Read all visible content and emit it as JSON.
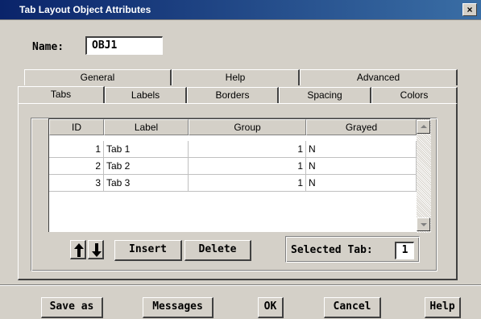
{
  "window": {
    "title": "Tab Layout Object Attributes",
    "close_glyph": "×"
  },
  "name_field": {
    "label": "Name:",
    "value": "OBJ1"
  },
  "tabs_back": [
    "General",
    "Help",
    "Advanced"
  ],
  "tabs_front": [
    "Tabs",
    "Labels",
    "Borders",
    "Spacing",
    "Colors"
  ],
  "active_tab": "Tabs",
  "table": {
    "columns": [
      "ID",
      "Label",
      "Group",
      "Grayed"
    ],
    "rows": [
      {
        "id": "1",
        "label": "Tab 1",
        "group": "1",
        "grayed": "N"
      },
      {
        "id": "2",
        "label": "Tab 2",
        "group": "1",
        "grayed": "N"
      },
      {
        "id": "3",
        "label": "Tab 3",
        "group": "1",
        "grayed": "N"
      }
    ]
  },
  "row_controls": {
    "move_up_icon": "arrow-up-icon",
    "move_down_icon": "arrow-down-icon",
    "insert_label": "Insert",
    "delete_label": "Delete"
  },
  "selected_tab": {
    "label": "Selected Tab:",
    "value": "1"
  },
  "footer_buttons": {
    "save_as": "Save as",
    "messages": "Messages",
    "ok": "OK",
    "cancel": "Cancel",
    "help": "Help"
  },
  "colors": {
    "title_bar": "#0a246a",
    "face": "#d4d0c8"
  }
}
